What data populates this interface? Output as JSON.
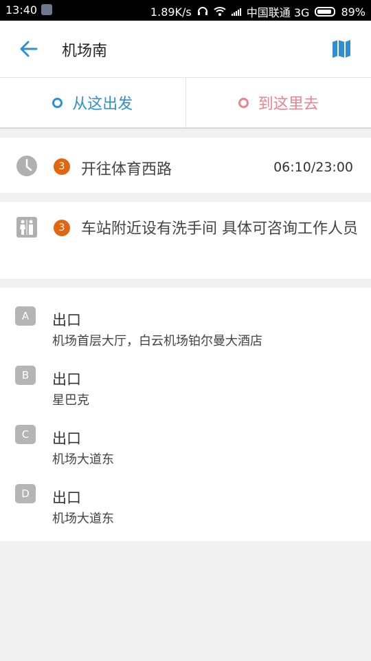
{
  "status": {
    "time": "13:40",
    "speed": "1.89K/s",
    "carrier": "中国联通 3G",
    "battery": "89%"
  },
  "header": {
    "title": "机场南"
  },
  "actions": {
    "from_label": "从这出发",
    "to_label": "到这里去"
  },
  "info": {
    "time": {
      "icon": "clock-icon",
      "badge": "3",
      "text": "开往体育西路",
      "value": "06:10/23:00"
    },
    "toilet": {
      "icon": "restroom-icon",
      "badge": "3",
      "text": "车站附近设有洗手间 具体可咨询工作人员"
    }
  },
  "exits": [
    {
      "letter": "A",
      "label": "出口",
      "desc": "机场首层大厅，白云机场铂尔曼大酒店"
    },
    {
      "letter": "B",
      "label": "出口",
      "desc": "星巴克"
    },
    {
      "letter": "C",
      "label": "出口",
      "desc": "机场大道东"
    },
    {
      "letter": "D",
      "label": "出口",
      "desc": "机场大道东"
    }
  ],
  "colors": {
    "accent": "#2f8fd0",
    "destination": "#e8838f",
    "badge": "#e2660e"
  }
}
